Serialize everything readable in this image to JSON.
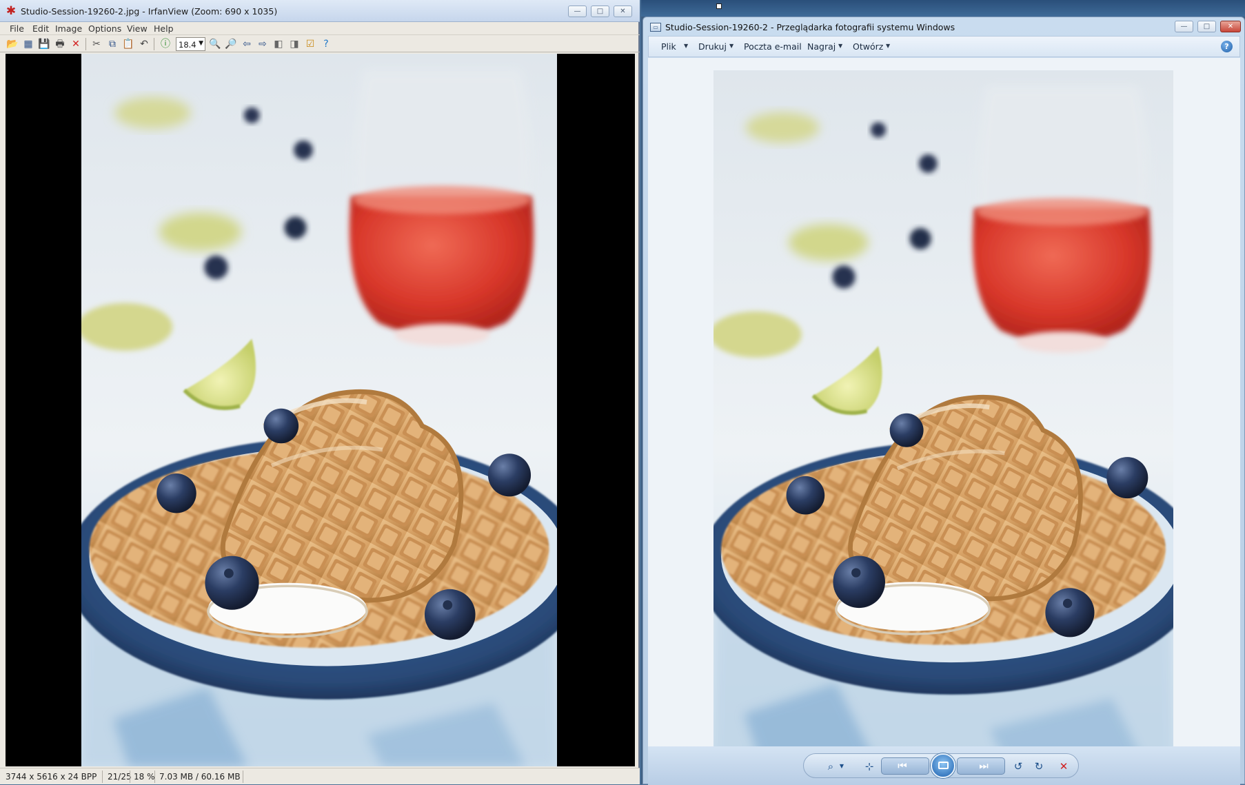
{
  "irfanview": {
    "title": "Studio-Session-19260-2.jpg - IrfanView (Zoom: 690 x 1035)",
    "caption_buttons": {
      "minimize": "—",
      "maximize": "□",
      "close": "✕"
    },
    "menu": [
      "File",
      "Edit",
      "Image",
      "Options",
      "View",
      "Help"
    ],
    "zoom_value": "18.4",
    "toolbar_icons": [
      "open-icon",
      "thumbnails-icon",
      "save-icon",
      "print-icon",
      "delete-icon",
      "cut-icon",
      "copy-icon",
      "paste-icon",
      "undo-icon",
      "info-icon",
      "zoom-in-icon",
      "zoom-out-icon",
      "previous-icon",
      "next-icon",
      "prev-page-icon",
      "next-page-icon",
      "properties-icon",
      "help-icon"
    ],
    "status": {
      "dimensions": "3744 x 5616 x 24 BPP",
      "index": "21/25",
      "zoom": "18 %",
      "memory": "7.03 MB / 60.16 MB"
    }
  },
  "photo_viewer": {
    "title": "Studio-Session-19260-2 - Przeglądarka fotografii systemu Windows",
    "caption_buttons": {
      "minimize": "—",
      "maximize": "□",
      "close": "✕"
    },
    "menu": [
      "Plik",
      "Drukuj",
      "Poczta e-mail",
      "Nagraj",
      "Otwórz"
    ],
    "help": "?",
    "control_icons": [
      "zoom-icon",
      "actual-size-icon",
      "previous-icon",
      "slideshow-icon",
      "next-icon",
      "rotate-left-icon",
      "rotate-right-icon",
      "delete-icon"
    ]
  },
  "colors": {
    "irfan_chrome": "#ece9e2",
    "viewer_frame": "#c9dcef",
    "plate": "#2a4a78",
    "juice": "#d8372a",
    "waffle": "#d9a468",
    "blueberry": "#1f2d4a"
  }
}
